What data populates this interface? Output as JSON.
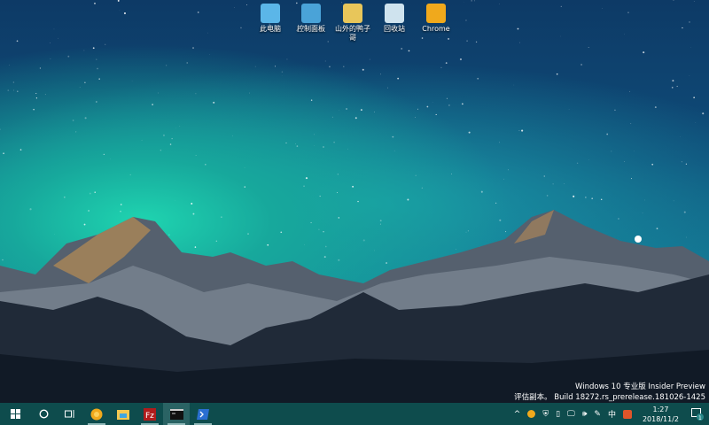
{
  "desktop": {
    "icons": [
      {
        "label": "此电脑",
        "color": "#5bb6e8"
      },
      {
        "label": "控制面板",
        "color": "#4aa3d8"
      },
      {
        "label": "山外的鸭子哥",
        "color": "#e8c65a"
      },
      {
        "label": "回收站",
        "color": "#cfe3ee"
      },
      {
        "label": "Chrome",
        "color": "#f0a91c"
      }
    ]
  },
  "watermark": {
    "line1": "Windows 10 专业版 Insider Preview",
    "line2": "评估副本。 Build 18272.rs_prerelease.181026-1425"
  },
  "taskbar": {
    "apps": [
      "start",
      "search",
      "task-view",
      "chrome",
      "file-explorer",
      "filezilla",
      "cmd",
      "powershell"
    ],
    "tray": {
      "chevron": "^",
      "ime": "中",
      "time": "1:27",
      "date": "2018/11/2",
      "notifications": "1"
    }
  }
}
